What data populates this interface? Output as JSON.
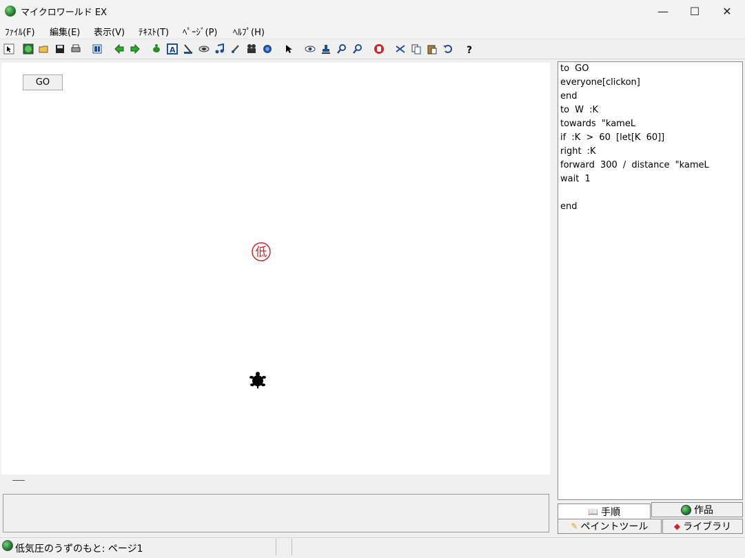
{
  "window": {
    "title": "マイクロワールド EX",
    "minimize": "—",
    "maximize": "☐",
    "close": "✕"
  },
  "menu": [
    "ﾌｧｲﾙ(F)",
    "編集(E)",
    "表示(V)",
    "ﾃｷｽﾄ(T)",
    "ﾍﾟｰｼﾞ(P)",
    "ﾍﾙﾌﾟ(H)"
  ],
  "toolbar": {
    "icons": [
      "cursor-icon",
      "world-icon",
      "open-folder-icon",
      "save-icon",
      "print-icon",
      "pages-icon",
      "back-arrow-icon",
      "forward-arrow-icon",
      "new-turtle-icon",
      "text-box-icon",
      "slider-icon",
      "button-icon",
      "music-icon",
      "paint-icon",
      "video-icon",
      "clip-icon",
      "pointer-icon",
      "eye-icon",
      "stamp-icon",
      "zoom-in-icon",
      "zoom-out-icon",
      "stop-icon",
      "cut-icon",
      "copy-icon",
      "paste-icon",
      "undo-icon",
      "help-icon"
    ]
  },
  "canvas": {
    "go_button": "GO",
    "low_pressure_marker": "低"
  },
  "code": {
    "lines": [
      "to GO",
      "everyone[clickon]",
      "end",
      "to W :K",
      "towards \"kameL",
      "if :K > 60 [let[K 60]]",
      "right :K",
      "forward 300 / distance \"kameL",
      "wait 1",
      "",
      "end"
    ]
  },
  "tabs": {
    "procedures": "手順",
    "works": "作品",
    "paint_tools": "ペイントツール",
    "library": "ライブラリ"
  },
  "status": {
    "text": "低気圧のうずのもと: ページ1"
  },
  "colors": {
    "marker": "#c8282e",
    "accent_green": "#1e7a2e"
  }
}
